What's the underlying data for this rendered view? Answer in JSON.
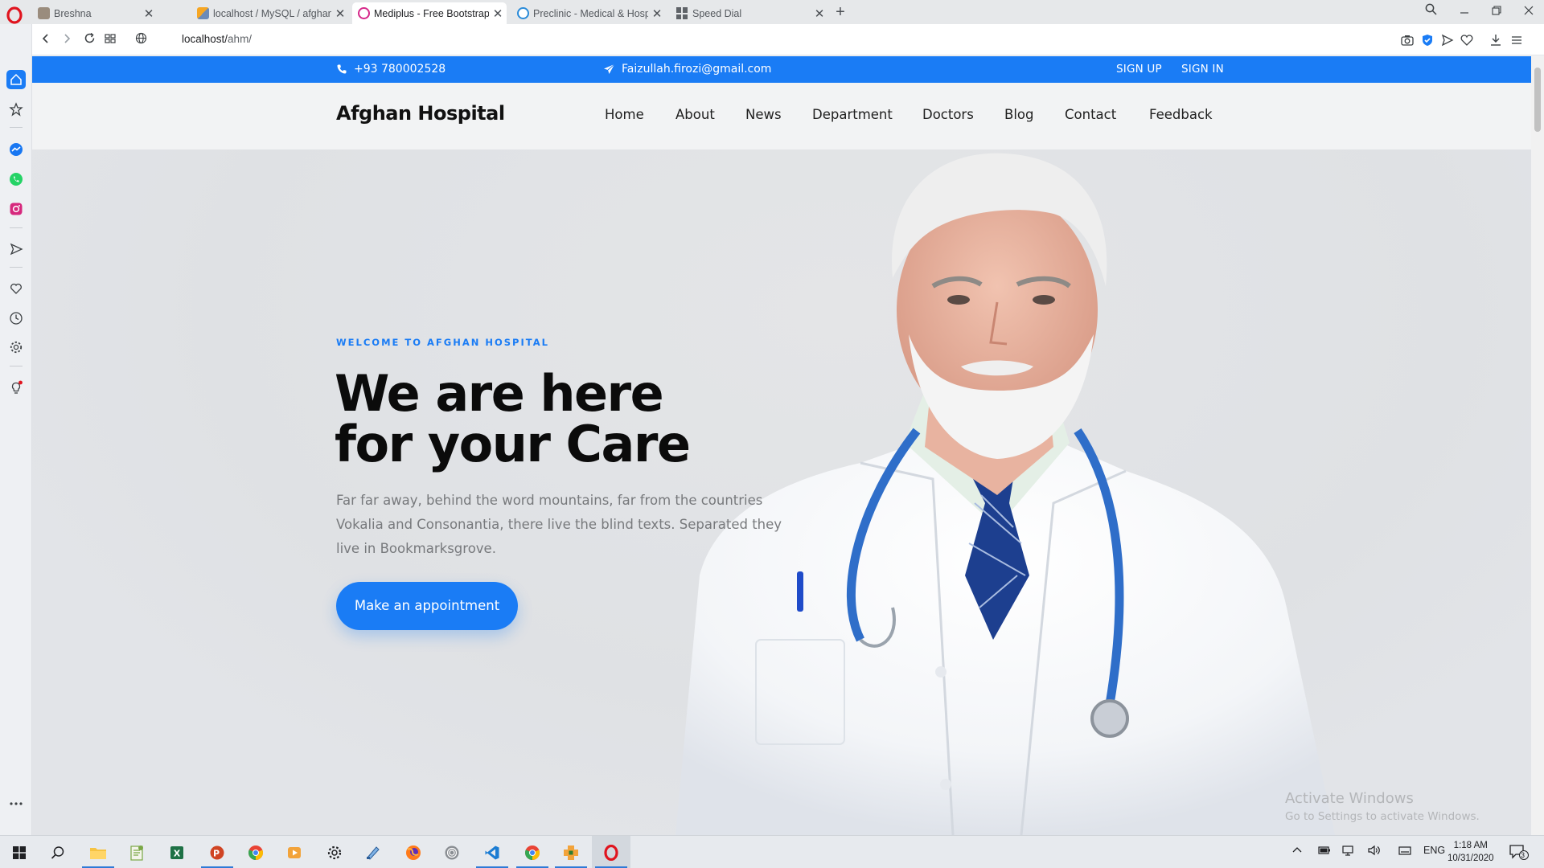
{
  "browser": {
    "tabs": [
      {
        "title": "Breshna",
        "active": false
      },
      {
        "title": "localhost / MySQL / afghan",
        "active": false
      },
      {
        "title": "Mediplus - Free Bootstrap",
        "active": true
      },
      {
        "title": "Preclinic - Medical & Hosp",
        "active": false
      },
      {
        "title": "Speed Dial",
        "active": false
      }
    ],
    "url_host": "localhost/",
    "url_path": "ahm/"
  },
  "site": {
    "topbar": {
      "phone": "+93 780002528",
      "email": "Faizullah.firozi@gmail.com",
      "signup": "SIGN UP",
      "signin": "SIGN IN"
    },
    "brand": "Afghan Hospital",
    "nav": [
      "Home",
      "About",
      "News",
      "Department",
      "Doctors",
      "Blog",
      "Contact",
      "Feedback"
    ],
    "hero": {
      "eyebrow": "WELCOME TO AFGHAN HOSPITAL",
      "title_line1": "We are here",
      "title_line2": "for your Care",
      "description": "Far far away, behind the word mountains, far from the countries Vokalia and Consonantia, there live the blind texts. Separated they live in Bookmarksgrove.",
      "cta": "Make an appointment"
    }
  },
  "watermark": {
    "line1": "Activate Windows",
    "line2": "Go to Settings to activate Windows."
  },
  "taskbar": {
    "lang": "ENG",
    "time": "1:18 AM",
    "date": "10/31/2020",
    "notifications": "3"
  },
  "colors": {
    "accent": "#1a7cf5",
    "opera_red": "#e0141e"
  }
}
